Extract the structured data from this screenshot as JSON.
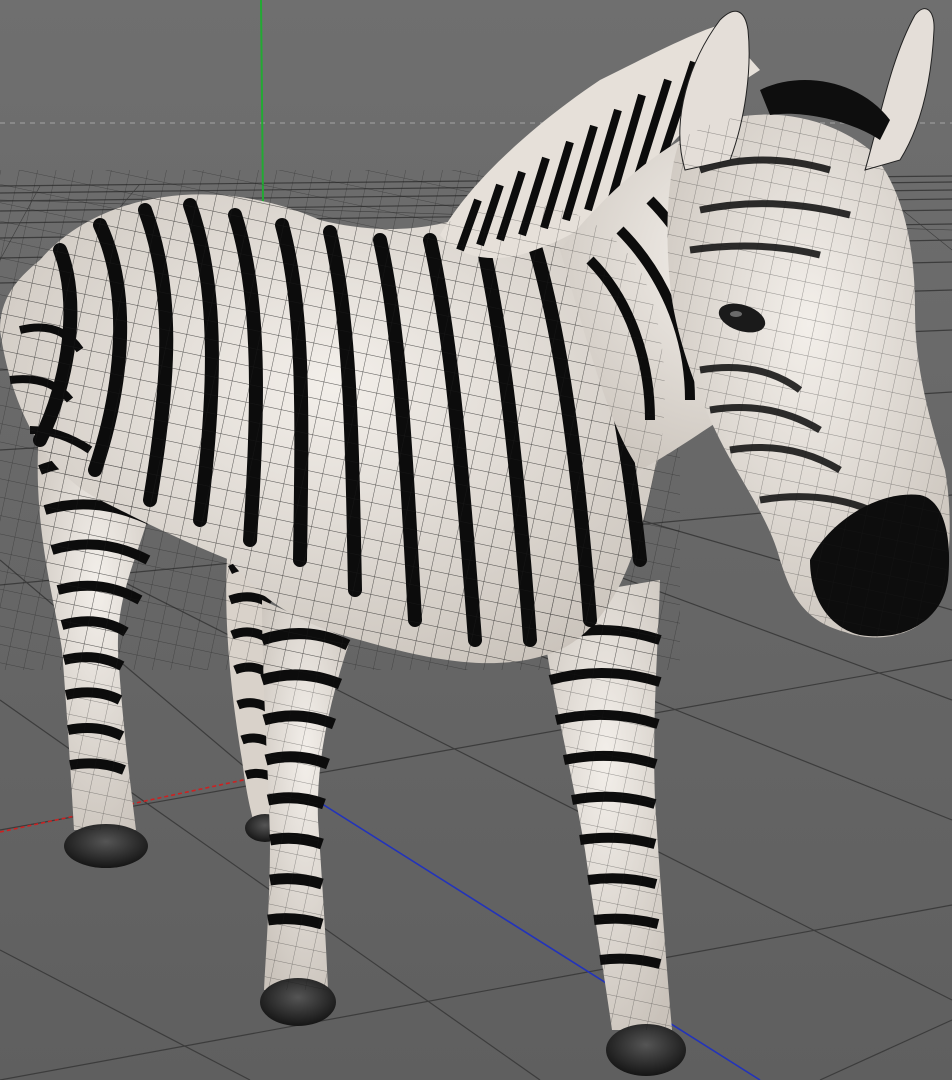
{
  "viewport": {
    "view": "perspective",
    "background_color": "#6b6b6b",
    "grid_color": "#3a3a3a",
    "horizon_color": "#9a9a9a"
  },
  "axes": {
    "x_axis_color": "#cc2222",
    "y_axis_color": "#22aa33",
    "z_axis_color": "#2233bb"
  },
  "model": {
    "subject": "zebra",
    "display_mode": "textured-wireframe",
    "skin_color": "#e8e2dc",
    "stripe_color": "#0c0c0c",
    "hoof_color": "#2a2a2a"
  }
}
